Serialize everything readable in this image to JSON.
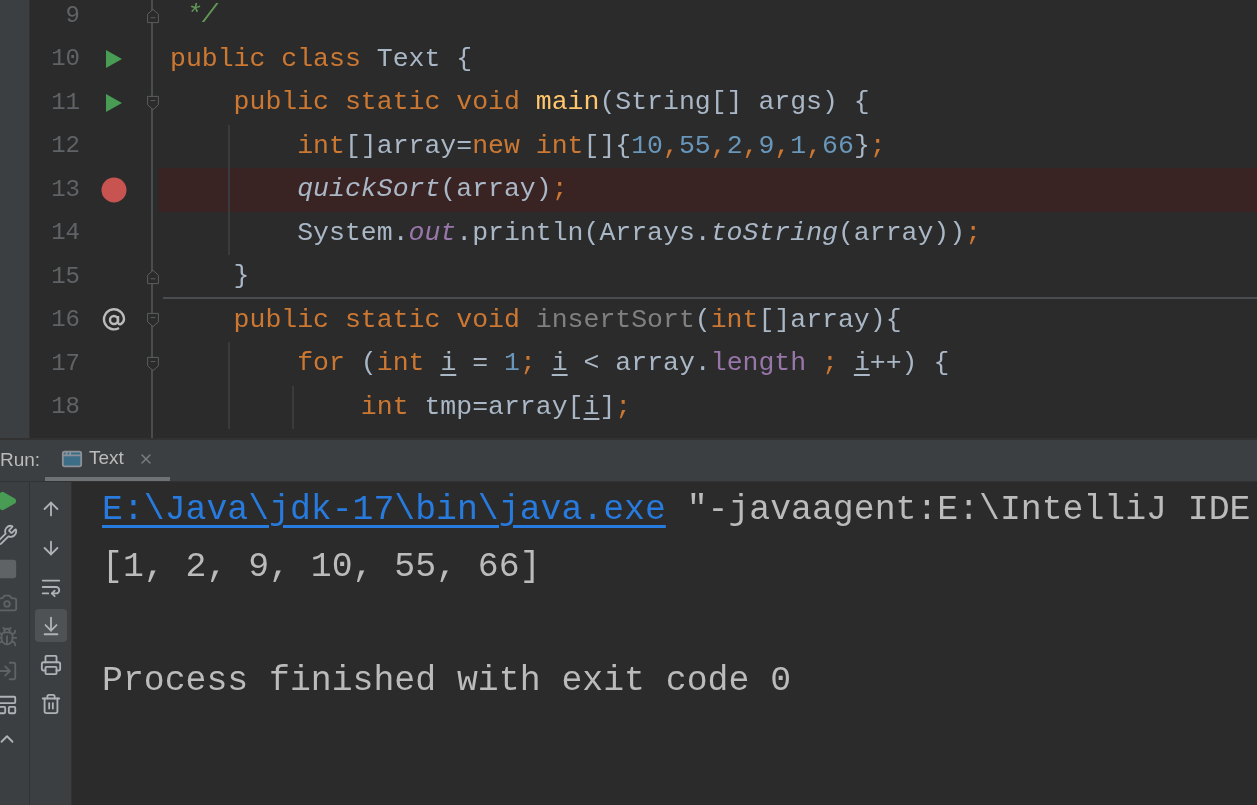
{
  "editor": {
    "lines": [
      {
        "number": "9",
        "fold": {
          "kind": "end"
        },
        "highlighted": false,
        "separator_below": false,
        "tokens": [
          {
            "text": " */",
            "kind": "comment"
          }
        ]
      },
      {
        "number": "10",
        "gutter_icon": {
          "kind": "run"
        },
        "highlighted": false,
        "separator_below": false,
        "tokens": [
          {
            "text": "public class ",
            "kind": "keyword"
          },
          {
            "text": "Text {",
            "kind": "plain"
          }
        ]
      },
      {
        "number": "11",
        "gutter_icon": {
          "kind": "run"
        },
        "fold": {
          "kind": "start"
        },
        "highlighted": false,
        "separator_below": false,
        "tokens": [
          {
            "text": "    public static void ",
            "kind": "keyword"
          },
          {
            "text": "main",
            "kind": "method"
          },
          {
            "text": "(String[] args) {",
            "kind": "plain"
          }
        ]
      },
      {
        "number": "12",
        "highlighted": false,
        "separator_below": false,
        "tokens": [
          {
            "text": "        int",
            "kind": "keyword"
          },
          {
            "text": "[]array=",
            "kind": "plain"
          },
          {
            "text": "new int",
            "kind": "keyword"
          },
          {
            "text": "[]{",
            "kind": "plain"
          },
          {
            "text": "10",
            "kind": "number"
          },
          {
            "text": ",",
            "kind": "keyword"
          },
          {
            "text": "55",
            "kind": "number"
          },
          {
            "text": ",",
            "kind": "keyword"
          },
          {
            "text": "2",
            "kind": "number"
          },
          {
            "text": ",",
            "kind": "keyword"
          },
          {
            "text": "9",
            "kind": "number"
          },
          {
            "text": ",",
            "kind": "keyword"
          },
          {
            "text": "1",
            "kind": "number"
          },
          {
            "text": ",",
            "kind": "keyword"
          },
          {
            "text": "66",
            "kind": "number"
          },
          {
            "text": "}",
            "kind": "plain"
          },
          {
            "text": ";",
            "kind": "keyword"
          }
        ]
      },
      {
        "number": "13",
        "gutter_icon": {
          "kind": "breakpoint"
        },
        "highlighted": true,
        "separator_below": false,
        "tokens": [
          {
            "text": "        quickSort",
            "kind": "static-method"
          },
          {
            "text": "(array)",
            "kind": "plain"
          },
          {
            "text": ";",
            "kind": "keyword"
          }
        ]
      },
      {
        "number": "14",
        "highlighted": false,
        "separator_below": false,
        "tokens": [
          {
            "text": "        System.",
            "kind": "plain"
          },
          {
            "text": "out",
            "kind": "static-field"
          },
          {
            "text": ".println(Arrays.",
            "kind": "plain"
          },
          {
            "text": "toString",
            "kind": "static-method"
          },
          {
            "text": "(array))",
            "kind": "plain"
          },
          {
            "text": ";",
            "kind": "keyword"
          }
        ]
      },
      {
        "number": "15",
        "fold": {
          "kind": "end"
        },
        "highlighted": false,
        "separator_below": true,
        "tokens": [
          {
            "text": "    }",
            "kind": "plain"
          }
        ]
      },
      {
        "number": "16",
        "gutter_icon": {
          "kind": "override"
        },
        "fold": {
          "kind": "start"
        },
        "highlighted": false,
        "separator_below": false,
        "tokens": [
          {
            "text": "    public static void ",
            "kind": "keyword"
          },
          {
            "text": "insertSort",
            "kind": "unused"
          },
          {
            "text": "(",
            "kind": "plain"
          },
          {
            "text": "int",
            "kind": "keyword"
          },
          {
            "text": "[]array){",
            "kind": "plain"
          }
        ]
      },
      {
        "number": "17",
        "fold": {
          "kind": "start"
        },
        "highlighted": false,
        "separator_below": false,
        "tokens": [
          {
            "text": "        for ",
            "kind": "keyword"
          },
          {
            "text": "(",
            "kind": "plain"
          },
          {
            "text": "int ",
            "kind": "keyword"
          },
          {
            "text": "i",
            "kind": "reassigned"
          },
          {
            "text": " = ",
            "kind": "plain"
          },
          {
            "text": "1",
            "kind": "number"
          },
          {
            "text": "; ",
            "kind": "keyword"
          },
          {
            "text": "i",
            "kind": "reassigned"
          },
          {
            "text": " < array.",
            "kind": "plain"
          },
          {
            "text": "length",
            "kind": "field"
          },
          {
            "text": " ; ",
            "kind": "keyword"
          },
          {
            "text": "i",
            "kind": "reassigned"
          },
          {
            "text": "++) {",
            "kind": "plain"
          }
        ]
      },
      {
        "number": "18",
        "highlighted": false,
        "separator_below": false,
        "tokens": [
          {
            "text": "            int ",
            "kind": "keyword"
          },
          {
            "text": "tmp=array[",
            "kind": "plain"
          },
          {
            "text": "i",
            "kind": "reassigned"
          },
          {
            "text": "]",
            "kind": "plain"
          },
          {
            "text": ";",
            "kind": "keyword"
          }
        ]
      }
    ]
  },
  "run_panel": {
    "label": "Run:",
    "tabs": [
      {
        "title": "Text",
        "selected": true
      }
    ],
    "side_toolbar": [
      {
        "disabled": false
      },
      {
        "disabled": false
      },
      {
        "disabled": true
      },
      {
        "disabled": true
      },
      {
        "disabled": true
      },
      {
        "disabled": true
      },
      {
        "disabled": false
      },
      {
        "disabled": false
      }
    ],
    "console_toolbar": [
      {
        "on": false
      },
      {
        "on": false
      },
      {
        "on": false
      },
      {
        "on": true
      },
      {
        "on": false
      },
      {
        "on": false
      }
    ],
    "console": {
      "lines": [
        {
          "segments": [
            {
              "text": "E:\\Java\\jdk-17\\bin\\java.exe",
              "kind": "link"
            },
            {
              "text": " \"-javaagent:E:\\IntelliJ IDE",
              "kind": "plain"
            }
          ]
        },
        {
          "segments": [
            {
              "text": "[1, 2, 9, 10, 55, 66]",
              "kind": "plain"
            }
          ]
        }
      ],
      "exit_message": "Process finished with exit code 0"
    }
  }
}
